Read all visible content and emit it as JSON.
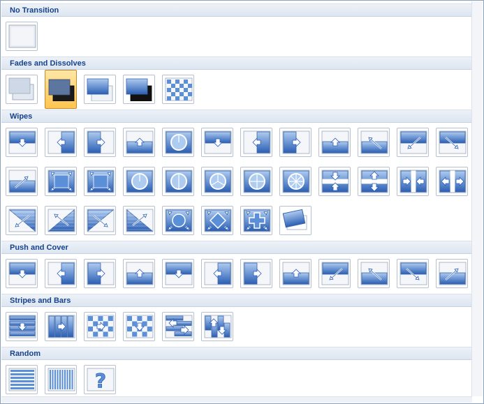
{
  "gallery": {
    "sections": [
      {
        "label": "No Transition",
        "tiles": [
          "no-transition"
        ]
      },
      {
        "label": "Fades and Dissolves",
        "tiles": [
          "fade-smoothly",
          "fade-through-black",
          "cut",
          "cut-through-black",
          "dissolve"
        ],
        "selected": 1
      },
      {
        "label": "Wipes",
        "tiles": [
          "wipe-down",
          "wipe-left",
          "wipe-right",
          "wipe-up",
          "wheel-clockwise-4",
          "uncover-down",
          "uncover-left",
          "uncover-right",
          "uncover-up",
          "uncover-left-up",
          "uncover-left-down",
          "uncover-right-down",
          "uncover-right-up",
          "box-in",
          "box-out",
          "wheel-1",
          "wheel-2",
          "wheel-3",
          "wheel-4",
          "wheel-8",
          "split-horizontal-in",
          "split-horizontal-out",
          "split-vertical-in",
          "split-vertical-out",
          "strips-left-down",
          "strips-left-up",
          "strips-right-down",
          "strips-right-up",
          "shape-circle",
          "shape-diamond",
          "shape-plus",
          "newsflash"
        ]
      },
      {
        "label": "Push and Cover",
        "tiles": [
          "push-down",
          "push-left",
          "push-right",
          "push-up",
          "cover-down",
          "cover-left",
          "cover-right",
          "cover-up",
          "cover-left-down",
          "cover-left-up",
          "cover-right-down",
          "cover-right-up"
        ]
      },
      {
        "label": "Stripes and Bars",
        "tiles": [
          "blinds-horizontal",
          "blinds-vertical",
          "checkerboard-across",
          "checkerboard-down",
          "comb-horizontal",
          "comb-vertical"
        ]
      },
      {
        "label": "Random",
        "tiles": [
          "random-bars-horizontal",
          "random-bars-vertical",
          "random-transition"
        ]
      }
    ]
  }
}
